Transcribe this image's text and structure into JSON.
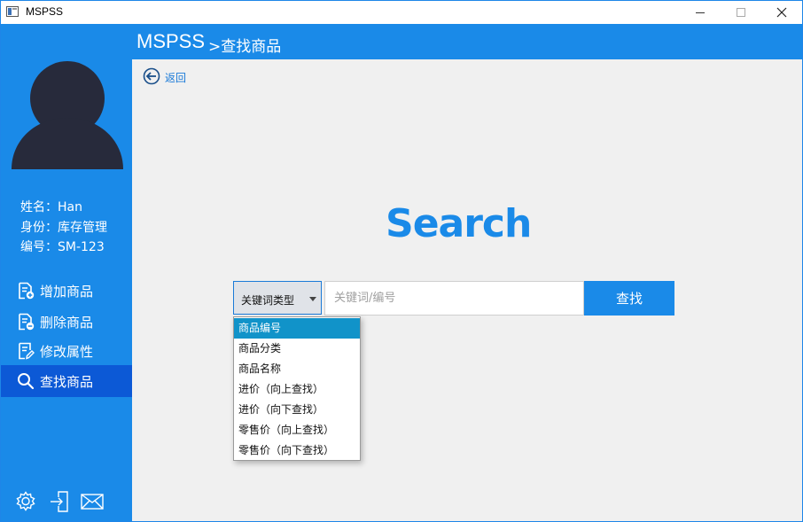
{
  "window": {
    "title": "MSPSS"
  },
  "header": {
    "brand": "MSPSS",
    "breadcrumb": ">查找商品"
  },
  "user": {
    "name_line": "姓名：Han",
    "role_line": "身份：库存管理",
    "id_line": "编号：SM-123"
  },
  "nav": [
    {
      "label": "增加商品",
      "icon": "add-document-icon",
      "active": false
    },
    {
      "label": "删除商品",
      "icon": "remove-document-icon",
      "active": false
    },
    {
      "label": "修改属性",
      "icon": "edit-document-icon",
      "active": false
    },
    {
      "label": "查找商品",
      "icon": "search-icon",
      "active": true
    }
  ],
  "bottom_icons": [
    "gear-icon",
    "logout-icon",
    "mail-icon"
  ],
  "main": {
    "back_label": "返回",
    "title": "Search",
    "type_select": {
      "label": "关键词类型"
    },
    "keyword_input": {
      "placeholder": "关键词/编号",
      "value": ""
    },
    "search_button": "查找",
    "dropdown": {
      "options": [
        "商品编号",
        "商品分类",
        "商品名称",
        "进价（向上查找）",
        "进价（向下查找）",
        "零售价（向上查找）",
        "零售价（向下查找）"
      ],
      "highlighted_index": 0
    }
  },
  "colors": {
    "primary": "#1a8ae8",
    "nav_active": "#0c59d6",
    "dropdown_highlight": "#1193c9",
    "avatar": "#272a3b"
  }
}
